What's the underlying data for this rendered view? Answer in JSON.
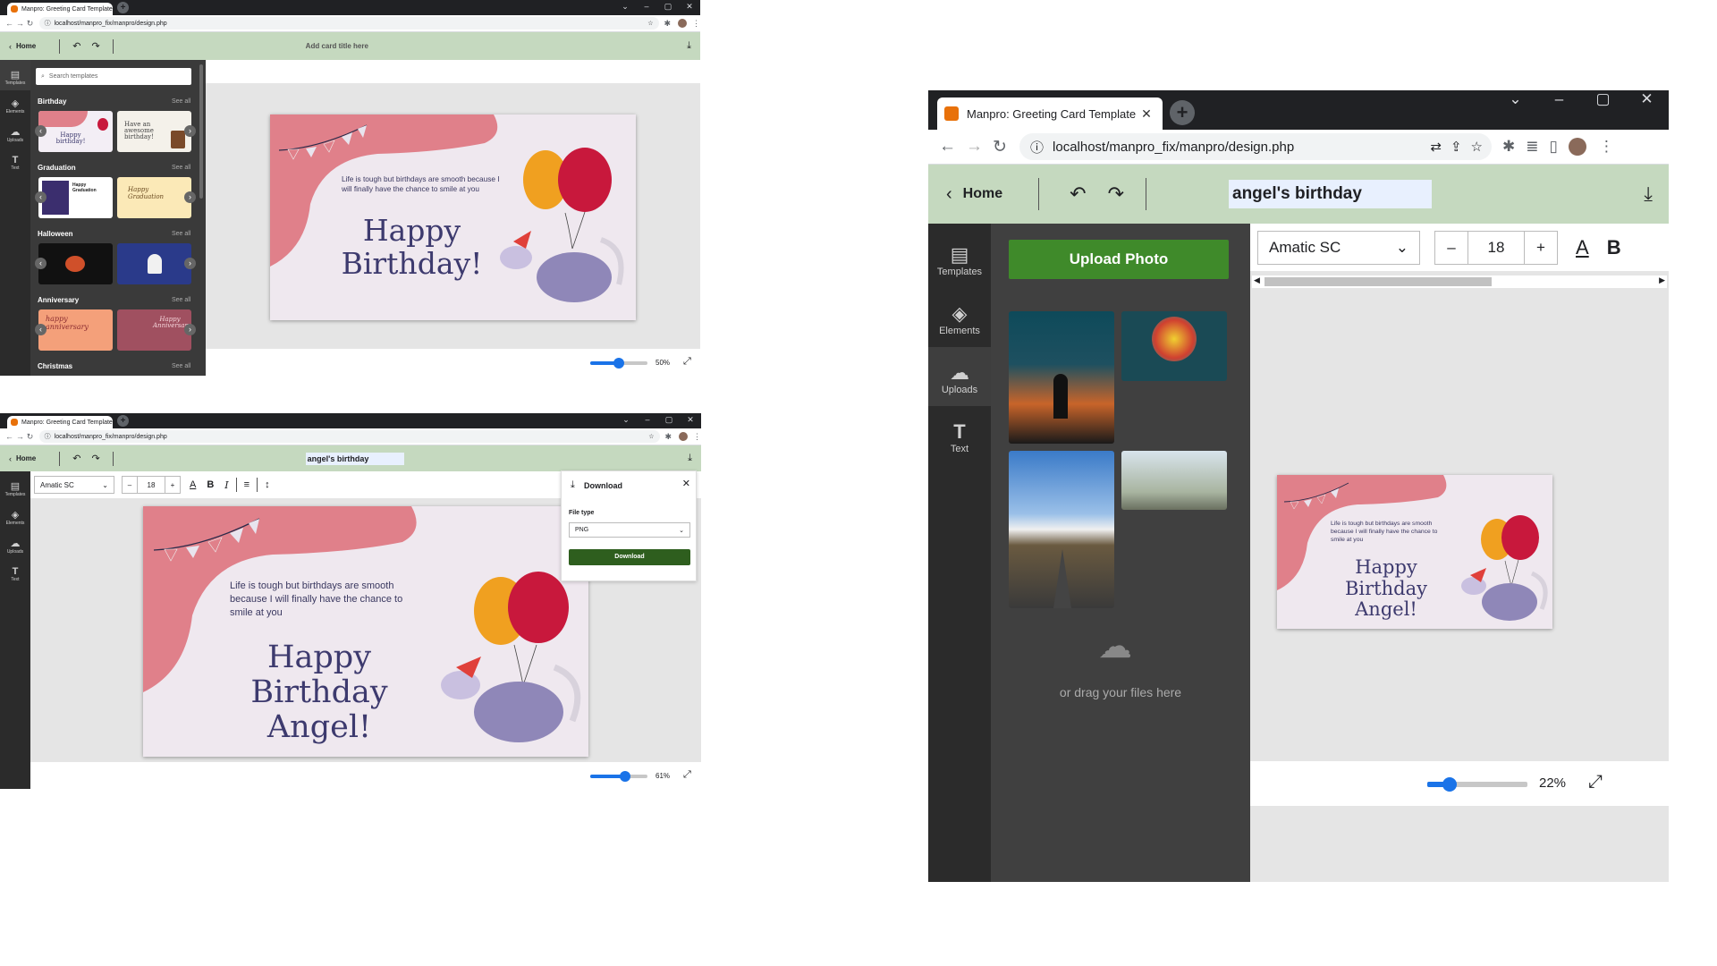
{
  "browser": {
    "tab_title": "Manpro: Greeting Card Template",
    "url": "localhost/manpro_fix/manpro/design.php",
    "new_tab": "+",
    "win_min": "–",
    "win_max": "▢",
    "win_close": "✕",
    "win_down": "⌄"
  },
  "app": {
    "home_label": "Home",
    "title_placeholder": "Add card title here",
    "card_title": "angel's birthday"
  },
  "rail": {
    "templates": "Templates",
    "elements": "Elements",
    "uploads": "Uploads",
    "text": "Text"
  },
  "templates_panel": {
    "search_placeholder": "Search templates",
    "categories": [
      "Birthday",
      "Graduation",
      "Halloween",
      "Anniversary",
      "Christmas"
    ],
    "see_all": "See all",
    "thumb_texts": [
      "Happy birthday!",
      "Have an awesome birthday!",
      "Happy Graduation",
      "Happy Graduation",
      "",
      "",
      "happy anniversary",
      "Happy Anniversary!"
    ]
  },
  "card": {
    "message": "Life is tough but birthdays are smooth because I will finally have the chance to smile at you",
    "greeting_1": "Happy Birthday!",
    "greeting_2_line1": "Happy Birthday",
    "greeting_2_line2": "Angel!"
  },
  "zoom": {
    "win1": "50%",
    "win2": "61%",
    "win3": "22%",
    "win1_level": 0.5,
    "win2_level": 0.61,
    "win3_level": 0.22
  },
  "text_toolbar": {
    "font": "Amatic SC",
    "size": "18",
    "minus": "–",
    "plus": "+"
  },
  "download_panel": {
    "title": "Download",
    "file_type_label": "File type",
    "file_type_value": "PNG",
    "button": "Download"
  },
  "uploads_panel": {
    "upload_button": "Upload Photo",
    "drag_text": "or drag your files here"
  },
  "colors": {
    "toolbar": "#c5d9bf",
    "upload_green": "#3f8a2a",
    "download_green": "#2e5e1e",
    "card_pink": "#e0808a",
    "card_bg": "#efe8ef"
  }
}
